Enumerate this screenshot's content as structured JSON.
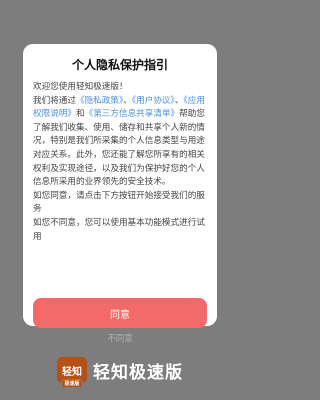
{
  "dialog": {
    "title": "个人隐私保护指引",
    "greeting": "欢迎您使用轻知极速版！",
    "p1_a": "我们将通过",
    "link_privacy": "《隐私政策》",
    "sep1": "、",
    "link_user": "《用户协议》",
    "sep2": "、",
    "link_permission": "《应用权限说明》",
    "and": "和",
    "link_thirdparty": "《第三方信息共享清单》",
    "p1_b": "帮助您了解我们收集、使用、储存和共享个人新的情况，特别是我们所采集的个人信息类型与用途对应关系。此外，您还能了解您所享有的相关权利及实现途径，以及我们为保护好您的个人信息所采用的业界领先的安全技术。",
    "p2": "如您同意，请点击下方按钮开始接受我们的服务",
    "p3": "如您不同意，您可以使用基本功能模式进行试用",
    "agree_label": "同意",
    "disagree_label": "不同意"
  },
  "splash": {
    "icon_text": "轻知",
    "icon_tag": "极速版",
    "app_name": "轻知极速版"
  },
  "colors": {
    "accent": "#f46a6a",
    "link": "#4a90e2",
    "overlay": "#7d7d7d"
  }
}
